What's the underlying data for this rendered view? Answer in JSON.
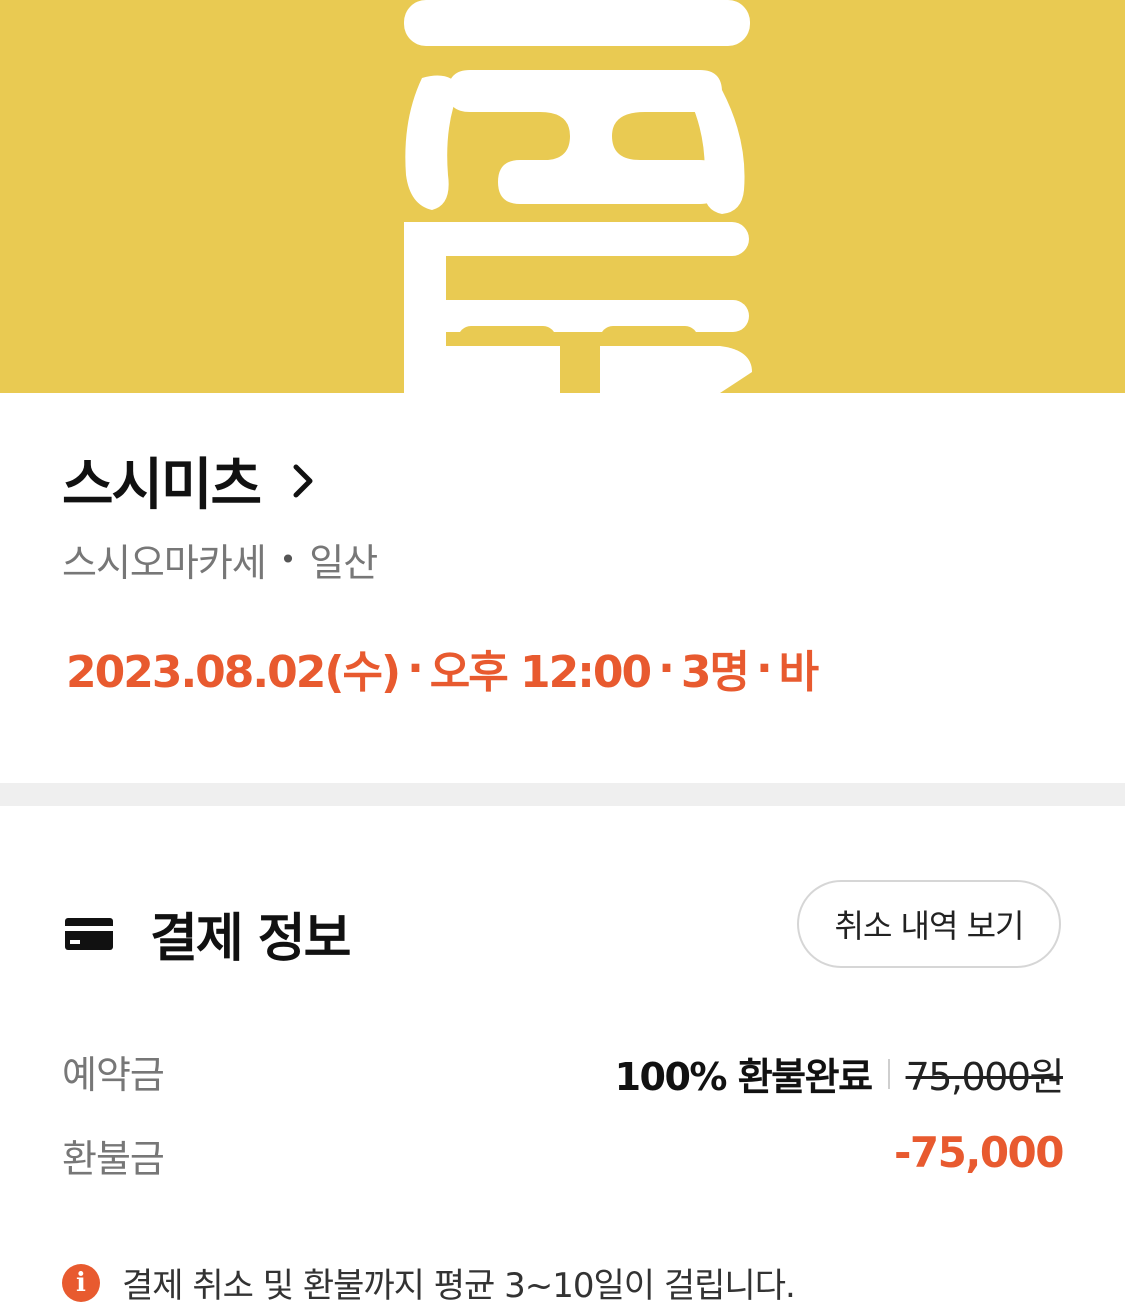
{
  "banner": {
    "background_color": "#e9ca52",
    "logo_color": "#ffffff",
    "icon": "restaurant-logo"
  },
  "restaurant": {
    "name": "스시미츠",
    "chevron_icon": "chevron-right-icon",
    "category": "스시오마카세",
    "separator": "•",
    "location": "일산",
    "booking": {
      "date": "2023.08.02(수)",
      "time": "오후 12:00",
      "party": "3명",
      "seat": "바",
      "separator": "·",
      "color": "#e85a2f"
    }
  },
  "payment": {
    "title": "결제 정보",
    "icon": "card-icon",
    "cancel_history_button": "취소 내역 보기",
    "rows": {
      "deposit": {
        "label": "예약금",
        "status": "100% 환불완료",
        "original_amount": "75,000원"
      },
      "refund": {
        "label": "환불금",
        "amount": "-75,000"
      }
    },
    "notice": {
      "icon": "info-icon",
      "icon_glyph": "i",
      "text": "결제 취소 및 환불까지 평균 3~10일이 걸립니다."
    }
  }
}
